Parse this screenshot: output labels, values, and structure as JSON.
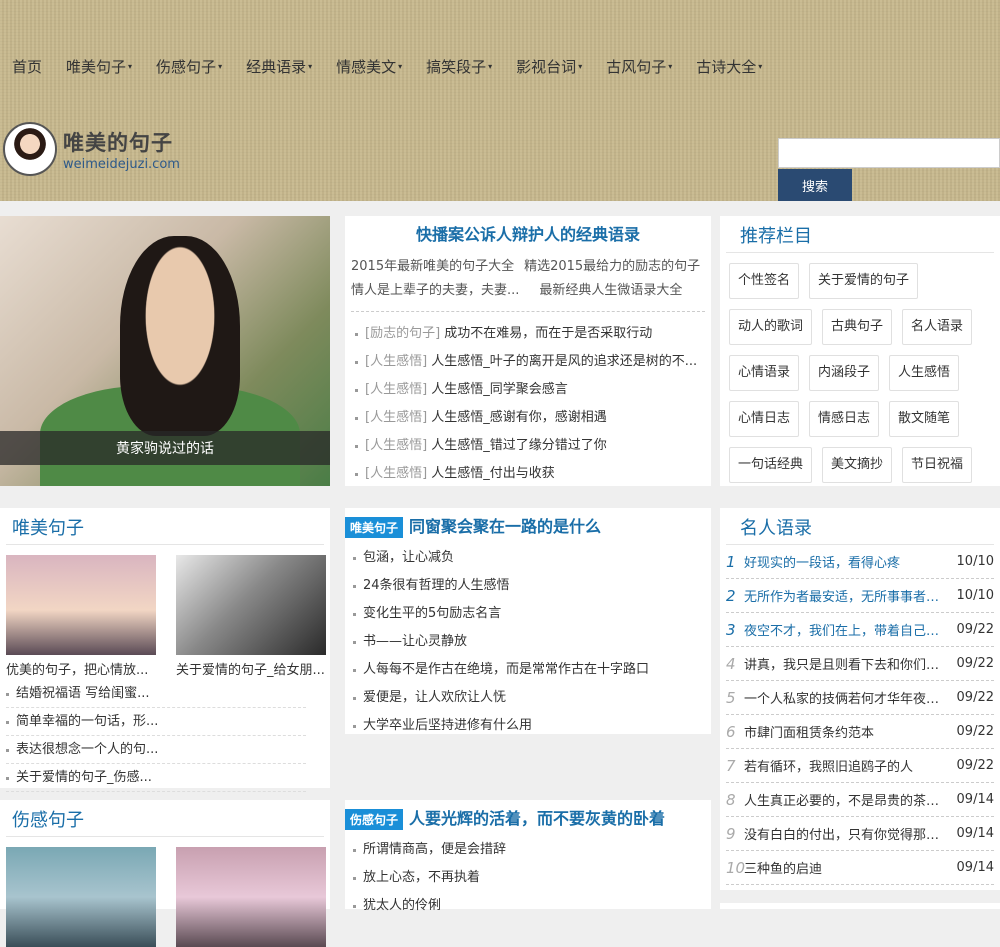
{
  "nav": {
    "home": "首页",
    "items": [
      "唯美句子",
      "伤感句子",
      "经典语录",
      "情感美文",
      "搞笑段子",
      "影视台词",
      "古风句子",
      "古诗大全"
    ],
    "caret": "▾"
  },
  "logo": {
    "cn": "唯美的句子",
    "en": "weimeidejuzi.com"
  },
  "search": {
    "placeholder": "",
    "button": "搜索"
  },
  "featured": {
    "caption": "黄家驹说过的话"
  },
  "top_article": {
    "title": "快播案公诉人辩护人的经典语录",
    "intro": [
      "2015年最新唯美的句子大全",
      "精选2015最给力的励志的句子",
      "情人是上辈子的夫妻，夫妻...",
      "最新经典人生微语录大全"
    ],
    "list": [
      {
        "cat": "[励志的句子]",
        "text": "成功不在难易，而在于是否采取行动"
      },
      {
        "cat": "[人生感悟]",
        "text": "人生感悟_叶子的离开是风的追求还是树的不..."
      },
      {
        "cat": "[人生感悟]",
        "text": "人生感悟_同学聚会感言"
      },
      {
        "cat": "[人生感悟]",
        "text": "人生感悟_感谢有你，感谢相遇"
      },
      {
        "cat": "[人生感悟]",
        "text": "人生感悟_错过了缘分错过了你"
      },
      {
        "cat": "[人生感悟]",
        "text": "人生感悟_付出与收获"
      }
    ]
  },
  "recommend": {
    "title": "推荐栏目",
    "tags": [
      "个性签名",
      "关于爱情的句子",
      "动人的歌词",
      "古典句子",
      "名人语录",
      "心情语录",
      "内涵段子",
      "人生感悟",
      "心情日志",
      "情感日志",
      "散文随笔",
      "一句话经典",
      "美文摘抄",
      "节日祝福"
    ]
  },
  "weimei": {
    "title": "唯美句子",
    "thumbs": [
      "优美的句子，把心情放...",
      "关于爱情的句子_给女朋..."
    ],
    "list": [
      "结婚祝福语 写给闺蜜...",
      "简单幸福的一句话，形...",
      "表达很想念一个人的句...",
      "关于爱情的句子_伤感..."
    ]
  },
  "mid2": {
    "badge": "唯美句子",
    "title": "同窗聚会聚在一路的是什么",
    "list": [
      "包涵，让心减负",
      "24条很有哲理的人生感悟",
      "变化生平的5句励志名言",
      "书——让心灵静放",
      "人每每不是作古在绝境，而是常常作古在十字路口",
      "爱便是，让人欢欣让人怃",
      "大学卒业后坚持进修有什么用"
    ]
  },
  "famous": {
    "title": "名人语录",
    "items": [
      {
        "num": "1",
        "text": "好现实的一段话，看得心疼",
        "date": "10/10"
      },
      {
        "num": "2",
        "text": "无所作为者最安适，无所事事者爱...",
        "date": "10/10"
      },
      {
        "num": "3",
        "text": "夜空不才，我们在上，带着自己的...",
        "date": "09/22"
      },
      {
        "num": "4",
        "text": "讲真，我只是且则看下去和你们一样",
        "date": "09/22"
      },
      {
        "num": "5",
        "text": "一个人私家的技俩若何才华年夜起...",
        "date": "09/22"
      },
      {
        "num": "6",
        "text": "市肆门面租赁条约范本",
        "date": "09/22"
      },
      {
        "num": "7",
        "text": "若有循环，我照旧追鸥子的人",
        "date": "09/22"
      },
      {
        "num": "8",
        "text": "人生真正必要的，不是昂贵的茶，...",
        "date": "09/14"
      },
      {
        "num": "9",
        "text": "没有白白的付出，只有你觉得那是...",
        "date": "09/14"
      },
      {
        "num": "10",
        "text": "三种鱼的启迪",
        "date": "09/14"
      }
    ]
  },
  "shanggan": {
    "title": "伤感句子"
  },
  "mid3": {
    "badge": "伤感句子",
    "title": "人要光辉的活着，而不要灰黄的卧着",
    "list": [
      "所谓情商高，便是会措辞",
      "放上心态，不再执着",
      "犹太人的伶俐"
    ]
  }
}
